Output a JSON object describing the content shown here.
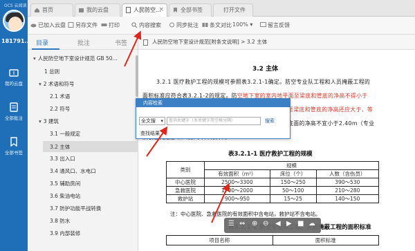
{
  "app": {
    "logo_text": "OCS 云阅读",
    "username": "181791..."
  },
  "rail": [
    {
      "label": "我的云盘",
      "icon": "cloud-disk-icon"
    },
    {
      "label": "全部批注",
      "icon": "annotations-icon"
    },
    {
      "label": "全部书签",
      "icon": "bookmark-icon"
    }
  ],
  "tabs": [
    {
      "label": "首页",
      "icon": "home-icon"
    },
    {
      "label": "我的云盘",
      "icon": "cloud-disk-icon"
    },
    {
      "label": "人民防空...",
      "icon": "document-icon",
      "active": true
    },
    {
      "label": "全部书签",
      "icon": "bookmark-icon"
    },
    {
      "label": "打开文件",
      "icon": ""
    }
  ],
  "toolbar": {
    "added": "已加入云盘",
    "save_as": "另存文件",
    "print": "打印",
    "content_search": "内容搜索",
    "sync_annotation": "同步批注",
    "compare": "条文对比",
    "zoom": "100%",
    "feedback": "留言反馈"
  },
  "sidebar": {
    "tabs": [
      "目录",
      "批注",
      "书签"
    ],
    "toc": [
      {
        "text": "人民防空地下室设计规范 GB 50...",
        "caret": "▾"
      },
      {
        "text": "1 总则",
        "caret": ""
      },
      {
        "text": "2 术语和符号",
        "caret": "▾"
      },
      {
        "text": "2.1 术语",
        "caret": ""
      },
      {
        "text": "2.2 符号",
        "caret": ""
      },
      {
        "text": "3 建筑",
        "caret": "▾"
      },
      {
        "text": "3.1 一般规定",
        "caret": ""
      },
      {
        "text": "3.2 主体",
        "caret": ""
      },
      {
        "text": "3.3 出入口",
        "caret": ""
      },
      {
        "text": "3.4 通风口、水电口",
        "caret": ""
      },
      {
        "text": "3.5 辅助房间",
        "caret": ""
      },
      {
        "text": "3.6 柴油电站",
        "caret": ""
      },
      {
        "text": "3.7 防护功能平战转换",
        "caret": ""
      },
      {
        "text": "3.8 防水",
        "caret": ""
      },
      {
        "text": "3.9 内部装修",
        "caret": ""
      }
    ]
  },
  "document": {
    "breadcrumb": "人民防空地下室设计规范[附条文说明] > 3.2 主体",
    "heading": "3.2  主体",
    "para1": "3.2.1  医疗救护工程的规模可参照表3.2.1-1确定。防空专业队工程和人员掩蔽工程的",
    "para2a": "面积标准应符合表3.2.1-2的规定。防",
    "para2b": "空地下室的室内地平面至梁底和管底的净高不得小于",
    "para3": "2.0m，其中专业队装备掩蔽部和人防汽车库的室内地平面至梁底和管底的净高还应大于、等",
    "para4": "于车高加0.2m。防空地下室的室内地平面至顶板的结构板底面的净高不宜小于2.40m（专业",
    "para5": "队装备掩蔽部和人防汽车库除外）。",
    "table_caption": "表3.2.1-1  医疗救护工程的规模",
    "table_head": {
      "type": "类别",
      "scale": "规模",
      "area": "有效面积（m²）",
      "beds": "床位（个）",
      "people": "人数（含伤员）"
    },
    "table_rows": [
      {
        "type": "中心医院",
        "area": "2500～3300",
        "beds": "150～250",
        "people": "390～530"
      },
      {
        "type": "急救医院",
        "area": "1700～2000",
        "beds": "50～100",
        "people": "210～280"
      },
      {
        "type": "救护站",
        "area": "900～950",
        "beds": "15～25",
        "people": "140～150"
      }
    ],
    "note": "注：中心医院、急救医院的有效面积中含电站，救护站不含电站。",
    "table2_caption": "表3.2.1-2  防空专业队工程、人员掩蔽工程的面积标准",
    "table2_head": {
      "name": "项目名称",
      "standard": "面积标准"
    }
  },
  "search_dialog": {
    "title": "内容检索",
    "scope": "全文搜",
    "placeholder": "查询关键字（多关键字用空格分隔）",
    "search_button": "搜索",
    "results_label": "查找结果"
  },
  "colors": {
    "rail": "#1f6fb8",
    "accent": "#2b79c2",
    "arrow": "#e0261b"
  }
}
